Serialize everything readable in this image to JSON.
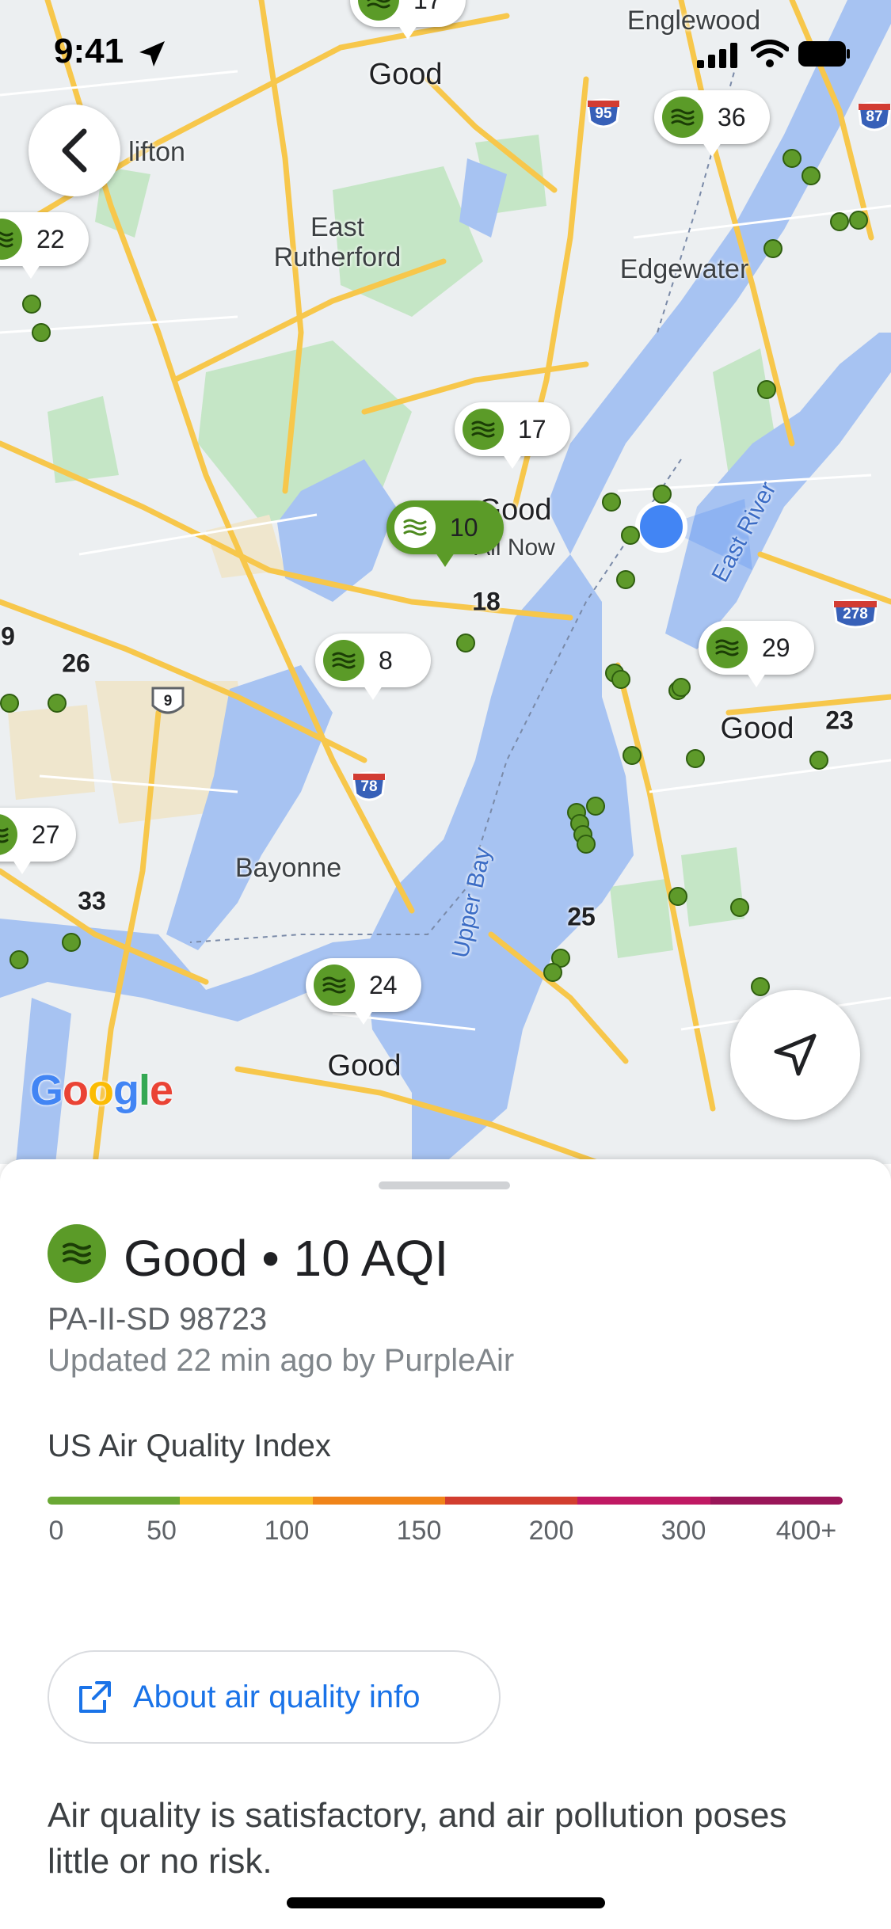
{
  "status_bar": {
    "time": "9:41"
  },
  "map": {
    "places": [
      {
        "name": "Englewood"
      },
      {
        "name": "lifton"
      },
      {
        "name": "East\nRutherford"
      },
      {
        "name": "Edgewater"
      },
      {
        "name": "Bayonne"
      },
      {
        "name": "Upper Bay"
      },
      {
        "name": "East River"
      },
      {
        "name": "All Now"
      }
    ],
    "good_labels": [
      "Good",
      "Good",
      "Good",
      "Good"
    ],
    "numbers": [
      "18",
      "26",
      "33",
      "25",
      "23",
      "9"
    ],
    "highways": [
      "95",
      "87",
      "278",
      "78",
      "9"
    ],
    "markers": [
      {
        "value": "17"
      },
      {
        "value": "36"
      },
      {
        "value": "22"
      },
      {
        "value": "17"
      },
      {
        "value": "10",
        "selected": true
      },
      {
        "value": "8"
      },
      {
        "value": "29"
      },
      {
        "value": "27"
      },
      {
        "value": "24"
      }
    ],
    "google_logo": "Google"
  },
  "sheet": {
    "headline": "Good • 10 AQI",
    "station": "PA-II-SD 98723",
    "updated": "Updated 22 min ago by PurpleAir",
    "scale_title": "US Air Quality Index",
    "scale_ticks": [
      "0",
      "50",
      "100",
      "150",
      "200",
      "300",
      "400+"
    ],
    "scale_colors": [
      "#6aa834",
      "#f9c02d",
      "#f08419",
      "#d23e2f",
      "#c01963",
      "#9a1659"
    ],
    "about_button": "About air quality info",
    "description": "Air quality is satisfactory, and air pollution poses little or no risk.",
    "aqi_color": "#5b9b28"
  }
}
